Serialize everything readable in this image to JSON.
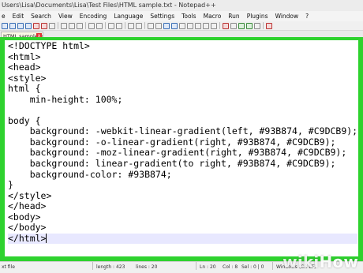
{
  "window": {
    "title": "Users\\Lisa\\Documents\\Lisa\\Test Files\\HTML sample.txt - Notepad++"
  },
  "menu": [
    "e",
    "Edit",
    "Search",
    "View",
    "Encoding",
    "Language",
    "Settings",
    "Tools",
    "Macro",
    "Run",
    "Plugins",
    "Window",
    "?"
  ],
  "tab": {
    "label": "HTML sample.txt",
    "close": "x"
  },
  "editor": {
    "lines": [
      "<!DOCTYPE html>",
      "<html>",
      "<head>",
      "<style>",
      "html {",
      "    min-height: 100%;",
      "",
      "body {",
      "    background: -webkit-linear-gradient(left, #93B874, #C9DCB9);",
      "    background: -o-linear-gradient(right, #93B874, #C9DCB9);",
      "    background: -moz-linear-gradient(right, #93B874, #C9DCB9);",
      "    background: linear-gradient(to right, #93B874, #C9DCB9);",
      "    background-color: #93B874;",
      "}",
      "</style>",
      "</head>",
      "<body>",
      "</body>",
      "</html>"
    ],
    "highlight_color": "#2ed22e"
  },
  "status": {
    "file_type": "xt file",
    "length": "length : 423",
    "lines": "lines : 20",
    "ln": "Ln : 20",
    "col": "Col : 8",
    "sel": "Sel : 0 | 0",
    "eol": "Windows (CR LF)"
  },
  "watermark": {
    "wiki": "wiki",
    "how": "How"
  }
}
